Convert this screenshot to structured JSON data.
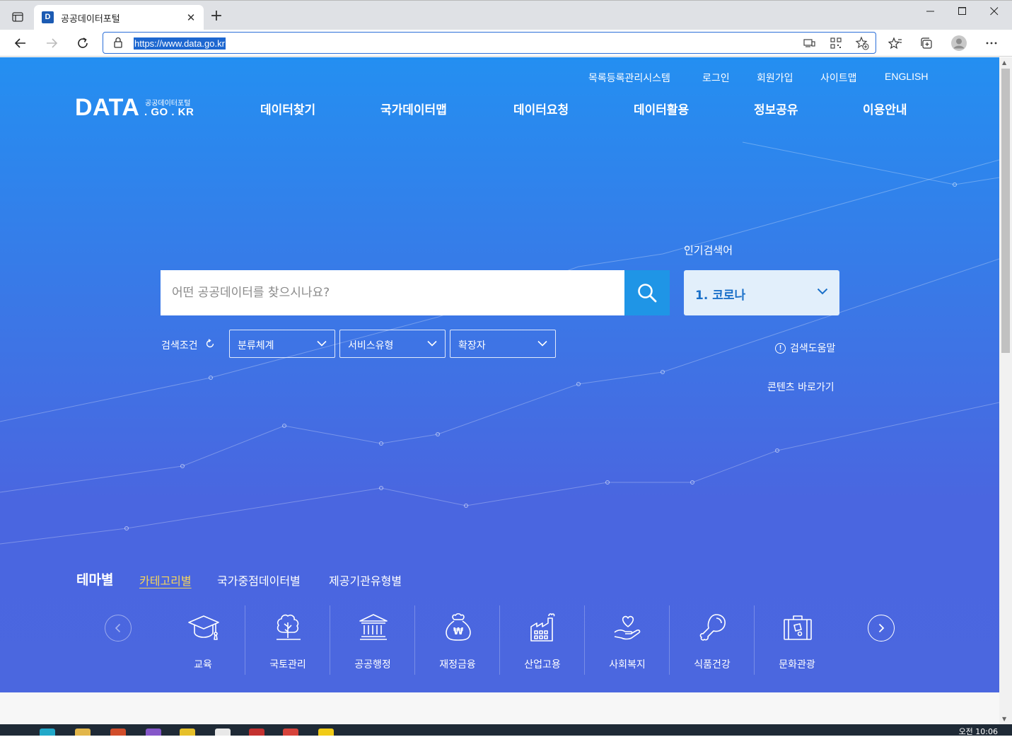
{
  "browser": {
    "tab_title": "공공데이터포털",
    "tab_favicon": "D",
    "url": "https://www.data.go.kr"
  },
  "utility_nav": [
    "목록등록관리시스템",
    "로그인",
    "회원가입",
    "사이트맵",
    "ENGLISH"
  ],
  "logo": {
    "main": "DATA",
    "subtitle": "공공데이터포털",
    "domain": ". GO . KR"
  },
  "gnb": [
    "데이터찾기",
    "국가데이터맵",
    "데이터요청",
    "데이터활용",
    "정보공유",
    "이용안내"
  ],
  "search": {
    "placeholder": "어떤 공공데이터를 찾으시나요?",
    "popular_label": "인기검색어",
    "popular_value": "1. 코로나",
    "conditions_label": "검색조건",
    "filters": [
      "분류체계",
      "서비스유형",
      "확장자"
    ],
    "help_label": "검색도움말",
    "content_link": "콘텐츠 바로가기"
  },
  "theme": {
    "title": "테마별",
    "tabs": [
      "카테고리별",
      "국가중점데이터별",
      "제공기관유형별"
    ],
    "active_tab": "카테고리별",
    "categories": [
      {
        "label": "교육",
        "icon": "graduation-cap-icon"
      },
      {
        "label": "국토관리",
        "icon": "tree-icon"
      },
      {
        "label": "공공행정",
        "icon": "government-building-icon"
      },
      {
        "label": "재정금융",
        "icon": "money-bag-icon"
      },
      {
        "label": "산업고용",
        "icon": "factory-icon"
      },
      {
        "label": "사회복지",
        "icon": "heart-hand-icon"
      },
      {
        "label": "식품건강",
        "icon": "drumstick-icon"
      },
      {
        "label": "문화관광",
        "icon": "suitcase-icon"
      }
    ]
  },
  "taskbar": {
    "clock": "오전 10:06"
  },
  "colors": {
    "hero_top": "#248ff1",
    "hero_bottom": "#4b67df",
    "search_button": "#1f95e6",
    "active_tab_text": "#f5d45a",
    "popular_text": "#1a70c9"
  }
}
